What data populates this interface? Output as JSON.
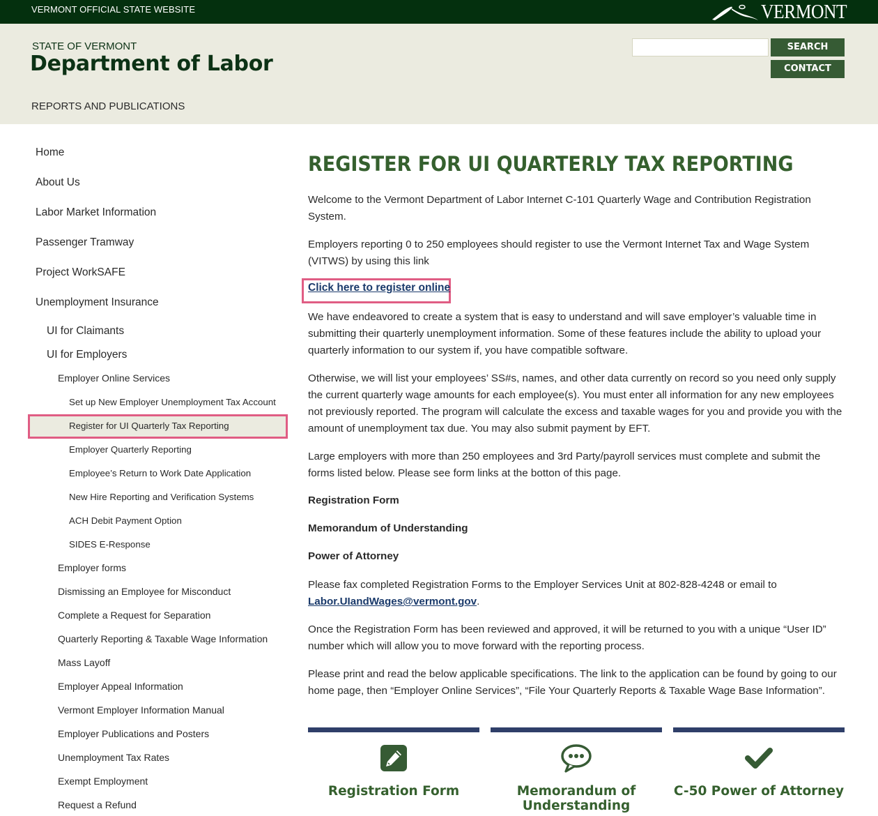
{
  "topbar": {
    "official_label": "VERMONT OFFICIAL STATE WEBSITE",
    "logo_text": "VERMONT"
  },
  "header": {
    "state_label": "STATE OF VERMONT",
    "department": "Department of Labor",
    "section_link": "REPORTS AND PUBLICATIONS",
    "search_placeholder": "",
    "search_value": "",
    "search_button": "SEARCH",
    "contact_button": "CONTACT"
  },
  "sidebar": {
    "items": [
      {
        "label": "Home",
        "level": 0
      },
      {
        "label": "About Us",
        "level": 0
      },
      {
        "label": "Labor Market Information",
        "level": 0
      },
      {
        "label": "Passenger Tramway",
        "level": 0
      },
      {
        "label": "Project WorkSAFE",
        "level": 0
      },
      {
        "label": "Unemployment Insurance",
        "level": 0
      },
      {
        "label": "UI for Claimants",
        "level": 1
      },
      {
        "label": "UI for Employers",
        "level": 1
      },
      {
        "label": "Employer Online Services",
        "level": 2
      },
      {
        "label": "Set up New Employer Unemployment Tax Account",
        "level": 3
      },
      {
        "label": "Register for UI Quarterly Tax Reporting",
        "level": 3,
        "active": true
      },
      {
        "label": "Employer Quarterly Reporting",
        "level": 3
      },
      {
        "label": "Employee’s Return to Work Date Application",
        "level": 3
      },
      {
        "label": "New Hire Reporting and Verification Systems",
        "level": 3
      },
      {
        "label": "ACH Debit Payment Option",
        "level": 3
      },
      {
        "label": "SIDES E-Response",
        "level": 3
      },
      {
        "label": "Employer forms",
        "level": 2
      },
      {
        "label": "Dismissing an Employee for Misconduct",
        "level": 2
      },
      {
        "label": "Complete a Request for Separation",
        "level": 2
      },
      {
        "label": "Quarterly Reporting & Taxable Wage Information",
        "level": 2
      },
      {
        "label": "Mass Layoff",
        "level": 2
      },
      {
        "label": "Employer Appeal Information",
        "level": 2
      },
      {
        "label": "Vermont Employer Information Manual",
        "level": 2
      },
      {
        "label": "Employer Publications and Posters",
        "level": 2
      },
      {
        "label": "Unemployment Tax Rates",
        "level": 2
      },
      {
        "label": "Exempt Employment",
        "level": 2
      },
      {
        "label": "Request a Refund",
        "level": 2
      }
    ]
  },
  "main": {
    "title": "REGISTER FOR UI QUARTERLY TAX REPORTING",
    "intro": "Welcome to the Vermont Department of Labor Internet C-101 Quarterly Wage and Contribution Registration System.",
    "employers_small": "Employers reporting 0 to 250 employees should register to use the Vermont Internet Tax and Wage System (VITWS) by using this link",
    "register_link": "Click here to register online",
    "endeavored": "We have endeavored to create a system that is easy to understand and will save employer’s valuable time in submitting their quarterly unemployment information. Some of these features include the ability to upload your quarterly information to our system if, you have compatible software.",
    "otherwise": "Otherwise, we will list your employees’ SS#s, names, and other data currently on record so you need only supply the current quarterly wage amounts for each employee(s). You must enter all information for any new employees not previously reported. The program will calculate the excess and taxable wages for you and provide you with the amount of unemployment tax due. You may also submit payment by EFT.",
    "large_employers": "Large employers with more than 250 employees and 3rd Party/payroll services must complete and submit the forms listed below. Please see form links at the botton of this page.",
    "forms": [
      "Registration Form",
      "Memorandum of Understanding",
      "Power of Attorney"
    ],
    "fax_text": "Please fax completed Registration Forms to the Employer Services Unit at 802-828-4248 or email to",
    "email": "Labor.UIandWages@vermont.gov",
    "fax_end": ".",
    "once_text": "Once the Registration Form has been reviewed and approved, it will be returned to you with a unique “User ID” number which will allow you to move forward with the reporting process.",
    "print_text": "Please print and read the below applicable specifications. The link to the application can be found by going to our home page, then “Employer Online Services”, “File Your Quarterly Reports & Taxable Wage Base Information”."
  },
  "cards": [
    {
      "label": "Registration Form",
      "icon": "pencil-square-icon"
    },
    {
      "label": "Memorandum of Understanding",
      "icon": "speech-bubble-icon"
    },
    {
      "label": "C-50 Power of Attorney",
      "icon": "checkmark-icon"
    }
  ],
  "colors": {
    "topbar_bg": "#04300e",
    "header_bg": "#ebebe0",
    "brand_green": "#35602e",
    "button_green": "#365b34",
    "link_blue": "#1a3a6b",
    "highlight_pink": "#e05d84",
    "card_bar": "#2f3f69"
  }
}
